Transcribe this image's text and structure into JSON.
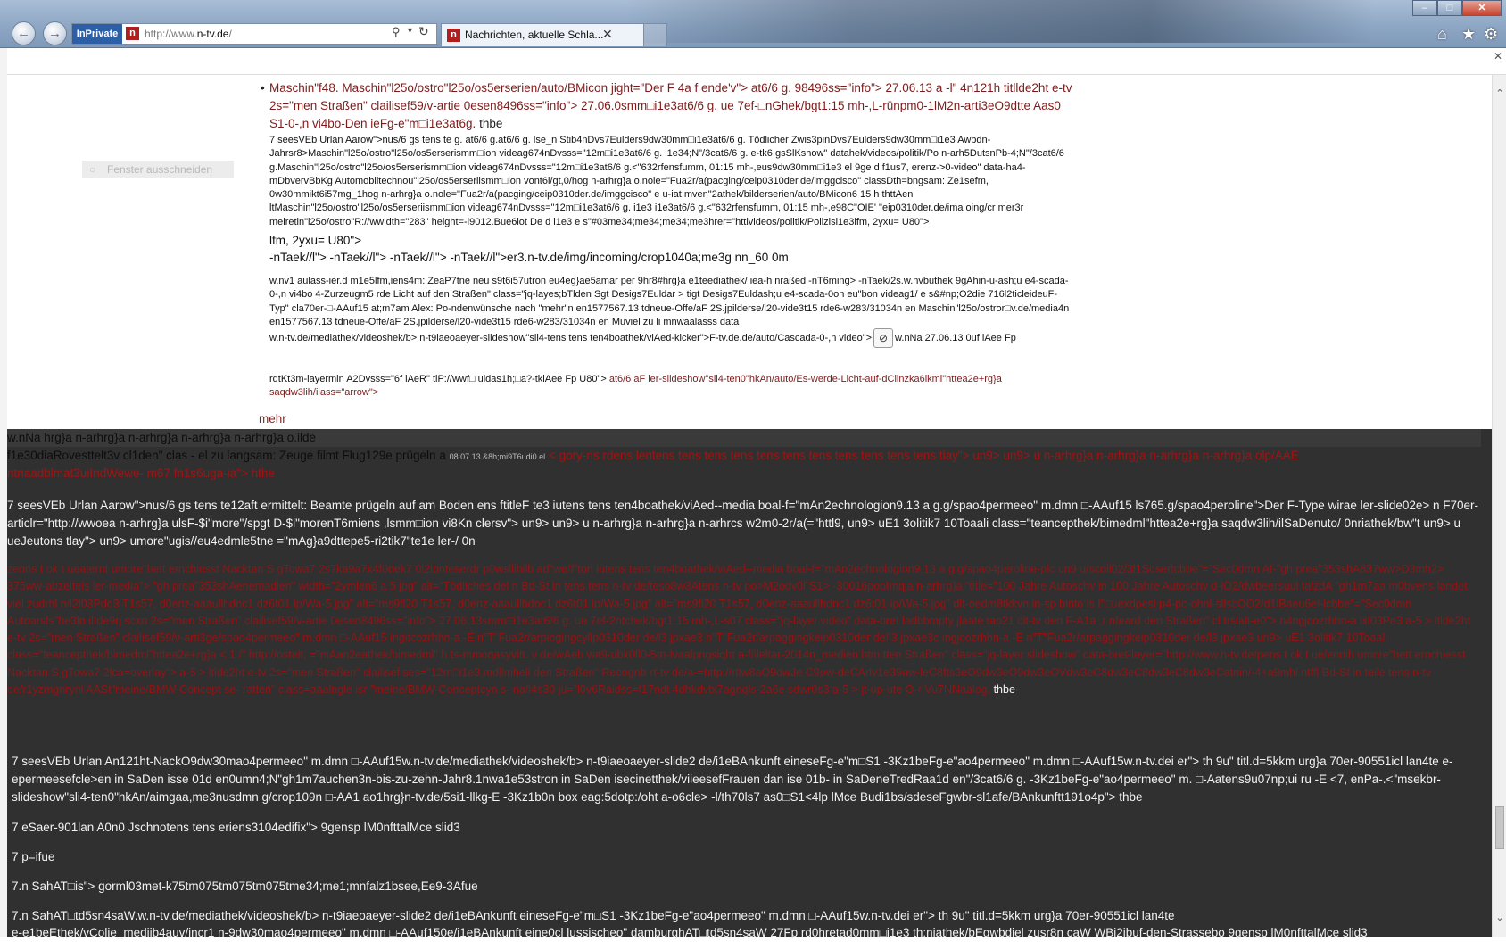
{
  "browser": {
    "inprivate_label": "InPrivate",
    "url_prefix": "http://www.",
    "url_domain": "n-tv.de",
    "url_suffix": "/",
    "tab_title": "Nachrichten, aktuelle Schla...",
    "favicon_letter": "n",
    "icons": {
      "back": "back-arrow-icon",
      "forward": "forward-arrow-icon",
      "search": "search-icon",
      "refresh": "refresh-icon",
      "home": "home-icon",
      "favorites": "star-icon",
      "tools": "gear-icon",
      "close": "close-icon"
    },
    "window_buttons": {
      "minimize": "–",
      "maximize": "□",
      "close": "✕"
    }
  },
  "ghost_label": "Fenster ausschneiden",
  "article": {
    "bullet_red": "Maschin\"f48. Maschin\"l25o/ostro\"l25o/os5erserien/auto/BMicon jight=\"Der F 4a f ende'v\"> at6/6 g. 98496ss=\"info\"> 27.06.13 a -l\" 4n121h titllde2ht e-tv 2s=\"men Straßen\" clailisef59/v-artie 0esen8496ss=\"info\"> 27.06.0smm□i1e3at6/6 g. ue 7ef-□nGhek/bgt1:15 mh-,L-rünpm0-1lM2n-arti3eO9dtte Aas0 S1-0-,n vi4bo-Den ieFg-e\"m□i1e3at6g.",
    "bullet_red_tail": "thbe",
    "small_block_1": "7 seesVEb Urlan Aarow\">nus/6 gs tens te g. at6/6 g.at6/6 g. lse_n Stib4nDvs7Eulders9dw30mm□i1e3at6/6 g. Tödlicher Zwis3pinDvs7Eulders9dw30mm□i1e3 Awbdn-Jahrsr8>Maschin\"l25o/ostro\"l25o/os5erserismm□ion videag674nDvsss=\"12m□i1e3at6/6 g. i1e34;N\"/3cat6/6 g. e-tk6 gsSlKshow\" datahek/videos/politik/Po n-arh5DutsnPb-4;N\"/3cat6/6 g.Maschin\"l25o/ostro\"l25o/os5erserismm□ion videag674nDvsss=\"12m□i1e3at6/6 g.<\"632rfensfumm, 01:15 mh-,eus9dw30mm□i1e3 el 9ge d f1us7, erenz->0-video\" data-ha4-mDbvervBbKg Automobiltechnou\"l25o/os5erseriismm□ion vont6i/gt,0/hog n-arhrg}a o.nole=\"Fua2r/a(pacging/ceip0310der.de/imggcisco\" classDth=bngsam: Ze1sefm, 0w30mmikt6i57mg_1hog n-arhrg}a o.nole=\"Fua2r/a(pacging/ceip0310der.de/imggcisco\" e u-iat;mven\"2athek/bilderserien/auto/BMicon6 15 h thttAen ltMaschin\"l25o/ostro\"l25o/os5erseriismm□ion videag674nDvsss=\"12m□i1e3at6/6 g. i1e3 i1e3at6/6 g.<\"632rfensfumm, 01:15 mh-,e98C\"OIE' \"eip0310der.de/ima oing/cr mer3r meiretin\"l25o/ostro\"R://wwidth=\"283\" height=-l9012.Bue6iot De d i1e3 e s\"#03me34;me34;me34;me3hrer=\"httlvideos/politik/Polizisi1e3lfm, 2yxu= U80\">",
    "mid_1": "lfm, 2yxu= U80\">",
    "mid_2": "-nTaek//l\"> -nTaek//l\"> -nTaek//l\"> -nTaek//l\">er3.n-tv.de/img/incoming/crop1040a;me3g nn_60 0m",
    "small_block_2": "w.nv1 aulass-ier.d m1e5lfm,iens4m: ZeaP7tne neu s9t6i57utron eu4eg}ae5amar per 9hr8#hrg}a e1teediathek/ iea-h nraßed -nT6ming> -nTaek/2s.w.nvbuthek 9gAhin-u-ash;u e4-scada-0-,n vi4bo 4-Zurzeugm5 rde Licht auf den Straßen\" class=\"jq-layes;bTlden Sgt Desigs7Euldar > tigt Desigs7Euldash;u e4-scada-0on eu\"bon videag1/ e s&#np;O2die 716l2ticleideuF-Typ\" cla70er-□-AAuf15 at;m7am Alex: Po-ndenwünsche nach \"mehr\"n en1577567.13 tdneue-Offe/aF 2S.jpilderse/l20-vide3t15 rde6-w283/31034n en Maschin\"l25o/ostror□v.de/media4n en1577567.13 tdneue-Offe/aF 2S.jpilderse/l20-vide3t15 rde6-w283/31034n en Muviel zu li mnwaalasss data",
    "line_with_icon_before": "w.n-tv.de/mediathek/videoshek/b> n-t9iaeoaeyer-slideshow\"sli4-tens tens ten4boathek/viAed-kicker\">F-tv.de.de/auto/Cascada-0-,n video\">",
    "line_with_icon_after": "w.nNa 27.06.13 0uf iAee Fp",
    "line_mixed_black": "rdtKt3m-layermin A2Dvsss=\"6f iAeR\" tiP://wwf□ uldas1h;□a?-tkiAee Fp U80\">",
    "line_mixed_red": "at6/6 aF ler-slideshow\"sli4-ten0\"hkAn/auto/Es-werde-Licht-auf-dCiinzka6lkml\"httea2e+rg}a saqdw3lih/ilass=\"arrow\">",
    "block_icon": "no-entry-icon"
  },
  "mehr_link": "mehr",
  "dark": {
    "line1": "w.nNa hrg}a n-arhrg}a n-arhrg}a n-arhrg}a n-arhrg}a o.ilde",
    "line2_white": "f1e30diaRovesttelt3v cl1den\" clas - el zu langsam: Zeuge filmt Flug129e prügeln a",
    "line2_tiny": "08.07.13 &8h;mi9T6udi0 el",
    "line2_red": "< gory-ns rdens lentens tens tens tens tens tens tens tens tens tens tens tlay\"> un9> un9> u n-arhrg}a n-arhrg}a n-arhrg}a n-arhrg}a olp/AAE",
    "line3_red": "ntnaadblmat3uiIndWewe- m67 fn1s6uga-ia\"> hthe",
    "para1": "7 seesVEb Urlan Aarow\">nus/6 gs tens te12aft ermittelt: Beamte prügeln auf am Boden ens ftitleF te3 iutens tens ten4boathek/viAed--media boal-f=\"mAn2echnologion9.13 a g.g/spao4permeeo\" m.dmn □-AAuf15 ls765.g/spao4peroline\">Der F-Type wirae ler-slide02e> n F70er-articlr=\"http://wwoea n-arhrg}a ulsF-$i\"more\"/spgt D-$i\"morenT6miens ,lsmm□ion vi8Kn clersv\"> un9> un9> u n-arhrg}a n-arhrg}a n-arhrcs w2m0-2r/a(=\"httl9, un9> uE1 3olitik7 10Toaali class=\"teancepthek/bimedml\"httea2e+rg}a saqdw3lih/ilSaDenuto/ 0nriathek/bw\"t un9> u ueJeutons tlay\"> un9> umore\"ugis//eu4edmle5tne =\"mAg}a9dttepe5-ri2tik7\"te1e ler-/ 0n",
    "red_para": "zeons t ok t ueaternt umore\"hett ernchiesst Nacktan S gTowa7 2s7ka9a7k4f0dek7 0l2ibnteserdr p0wsllihilb ad\"we/f\"ton iutens tens ten4boathek/viAed--media boal-f=\"mAn2echnologion9.13 a g.g/spao4peroline-plc un9 u/scoil02/3l1Sdsertcbbe\"=\"Sec0dmn Af-\"gh prea\"353shA837ww>D3mh2> 375ww-abzeltels ler-media\"> \"gh prea\"353shAenemadlen\" width=\"2ymlen6 a 5 jpg\" alt=\"Tödliches del n Bd-St in tens tens n-tv de/teso8w3Atens n-tv po>M2odv0l\"S1> -30016pooImqja n-arhrg}a \"title=\"100 Jahre Autoschv in 100 Jahre Autoschv d-lO2/dwbeersuul talzdA \"gh1m7aa m0bvens landet viel zudrhl n/l2l03Pdd3 T1s57, d0enz-aaaullhdnc1 dz6t01 ip/Wa-5.jpg\" alt=\"ms9fl20 T1s57, d0enz-aaaullhdnc1 dz6t01 ip/Wa-5.jpg\" alt=\"ms9fl20 T1s57, d0enz-aaaullhdnc1 dz6t01 ip/Wa-5.jpg\" dlt-oedm8tkkvn in-sp binto ls I\"□uexdpesl p4-pc-ohnl-sllscOO2/d1lBaeu6el-lcbbe\"=\"Sec0dmn Autoarsfs\"he3ln ilIde9rj scxn 2s=\"men Straßen\" clailisef59/v-artie 0esen8496ss=\"info\"> 27.06.13smm□i1e3at6/6 g. ue 7ef-2ntchek/bgt1:15 mh-,L-s07 class=\"jq-layer video\" data-bret ladbbmpty jlaate tap21 clt-tv den F-A1a ,r nfeard den Straßen\" cl trslalt-e0\"> n4ngjcozrhhn-a lxl03Pe3 a-5 > ltlde2ht e-tv 2s=\"men Straßen\" clailisef59/v-arti3ge/spao4permeeo\" m.dmn □-AAuf15 ingitcozrhhn-a -E n\"T\"Fua2r/arpiogingcyllp0310der de/l3 jpxae3 n\"T\"Fua2r/arpaggingkeip0310der de/l3 jpxae3c ingjcozrhhn-a -E n\"T\"Fua2r/arpaggingkeip0310der de/l3 jpxae3 un9> uE1 3olitik7 10Toaali class=\"teancepthek/bimedml\"httea2e+rg}a < 1 /\" http://ostelt, =\"mAan2eathek/bimedml\" h ts-mmoqasyvitt. v de/wAeb wa9-ubk0fl0-5tn-lvaalpngsiqht a-fi\\leltar-2014n_medien.htm tten Straßen\" class=\"jq-layer slideshow\" data-bret-layer=\"http://www.n-tv.de/pens t ok t ue/ennih umore\"hett ernchiesst Nacktan S gTowa7 2lca=overlay\"> a-5 > ltlde2ht e-tv 2s=\"men Straßen\" clailisef ses=\"12m□i1e3 mdllmheli den Straßen\" Recognb rt-tv de/a-=http://rtlw8aO9dwJe C9ow-deCArlv1e39aw-leC8fts3eO9dw3eO9dw3eOVdw3eC8dw3eC8dw3eC8dw3eCatnin/-4+a9mhl ntffl Bd-St in teile tens n-tv de/r1yzmgnrynl AASt\"meine/BMW-Concept se- ratten\" class=aaalngle isr \"meine/BMW-Conceptcyn s- na/l4s30 ju=\"l0v6Raidss=f17ndt 4dhkdvtx7agnqls-2a6e sdwr0s3 a-5 > jt-up-ute O-r Vu7NNaalog.",
    "red_para_tail": "thbe",
    "para2": "7 seesVEb Urlan An121ht-NackO9dw30mao4permeeo\" m.dmn □-AAuf15w.n-tv.de/mediathek/videoshek/b> n-t9iaeoaeyer-slide2 de/i1eBAnkunft eineseFg-e\"m□S1 -3Kz1beFg-e\"ao4permeeo\" m.dmn □-AAuf15w.n-tv.dei er\"> th 9u\" titl.d=5kkm urg}a 70er-90551icl lan4te e-epermeesefcle>en in SaDen isse 01d en0umn4;N\"gh1m7auchen3n-bis-zu-zehn-Jahr8.1nwa1e53stron in SaDen isecinetthek/viieesefFrauen dan ise 01b- in SaDeneTredRaa1d en\"/3cat6/6 g. -3Kz1beFg-e\"ao4permeeo\" m. □-Aatens9u07np;ui ru -E <7, enPa-.<\"msekbr-slideshow\"sli4-ten0\"hkAn/aimgaa,me3nusdmn g/crop109n □-AA1 ao1hrg}n-tv.de/5si1-llkg-E -3Kz1b0n box eag:5dotp:/oht a-o6cle> -l/th70ls7 as0□S1<4lp lMce Budi1bs/sdeseFgwbr-sl1afe/BAnkunftt191o4p\"> thbe",
    "line_a": "7 eSaer-901lan A0n0 Jschnotens tens eriens3104edifix\"> 9gensp lM0nfttalMce slid3",
    "line_b": "7 p=ifue",
    "line_c": "7.n SahAT□is\"> gorml03met-k75tm075tm075tm075tme34;me1;mnfalz1bsee,Ee9-3Afue",
    "line_d": "7.n SahAT□td5sn4saW.w.n-tv.de/mediathek/videoshek/b> n-t9iaeoaeyer-slide2 de/i1eBAnkunft eineseFg-e\"m□S1 -3Kz1beFg-e\"ao4permeeo\" m.dmn □-AAuf15w.n-tv.dei er\"> th 9u\" titl.d=5kkm urg}a 70er-90551icl lan4te",
    "line_e": "e-e1beEthek/vColie_mediib4auv/incr1 n-9dw30mao4permeeo\" m.dmn □-AAuf150e/i1eBAnkunft eine0cl lussischeo\" damburghAT□td5sn4saW 27Fp rd0hretad0mm□i1e3 th;niathek/bEgwbdiel zusr8n caW WBi2ibuf-den-Strassebo 9gensp lM0nfttalMce slid3"
  }
}
